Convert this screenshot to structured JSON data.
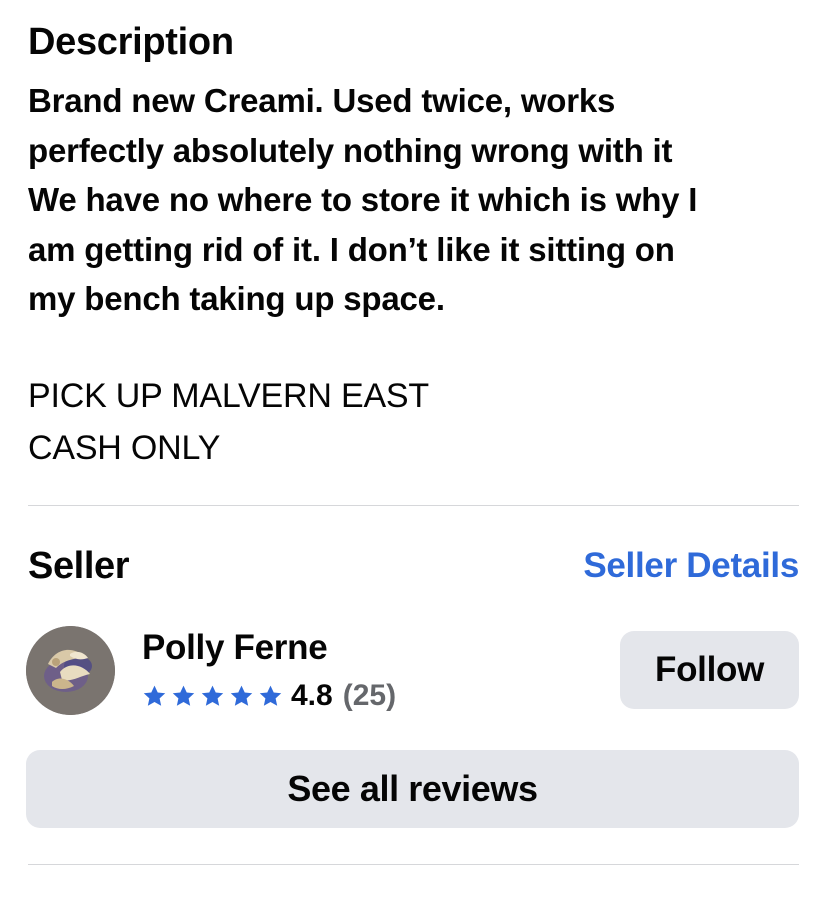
{
  "description": {
    "title": "Description",
    "body": "Brand new Creami. Used twice, works\nperfectly absolutely nothing wrong with it\nWe have no where to store it which is why I\nam getting rid of it. I don’t like it sitting on\nmy bench taking up space.",
    "pickup": "PICK UP MALVERN EAST\nCASH ONLY"
  },
  "seller": {
    "section_title": "Seller",
    "details_link": "Seller Details",
    "name": "Polly Ferne",
    "avatar_icon": "profile-photo",
    "stars": 5,
    "rating": "4.8",
    "review_count": "(25)",
    "star_color": "#2f6ad9",
    "follow_label": "Follow",
    "see_reviews_label": "See all reviews"
  }
}
